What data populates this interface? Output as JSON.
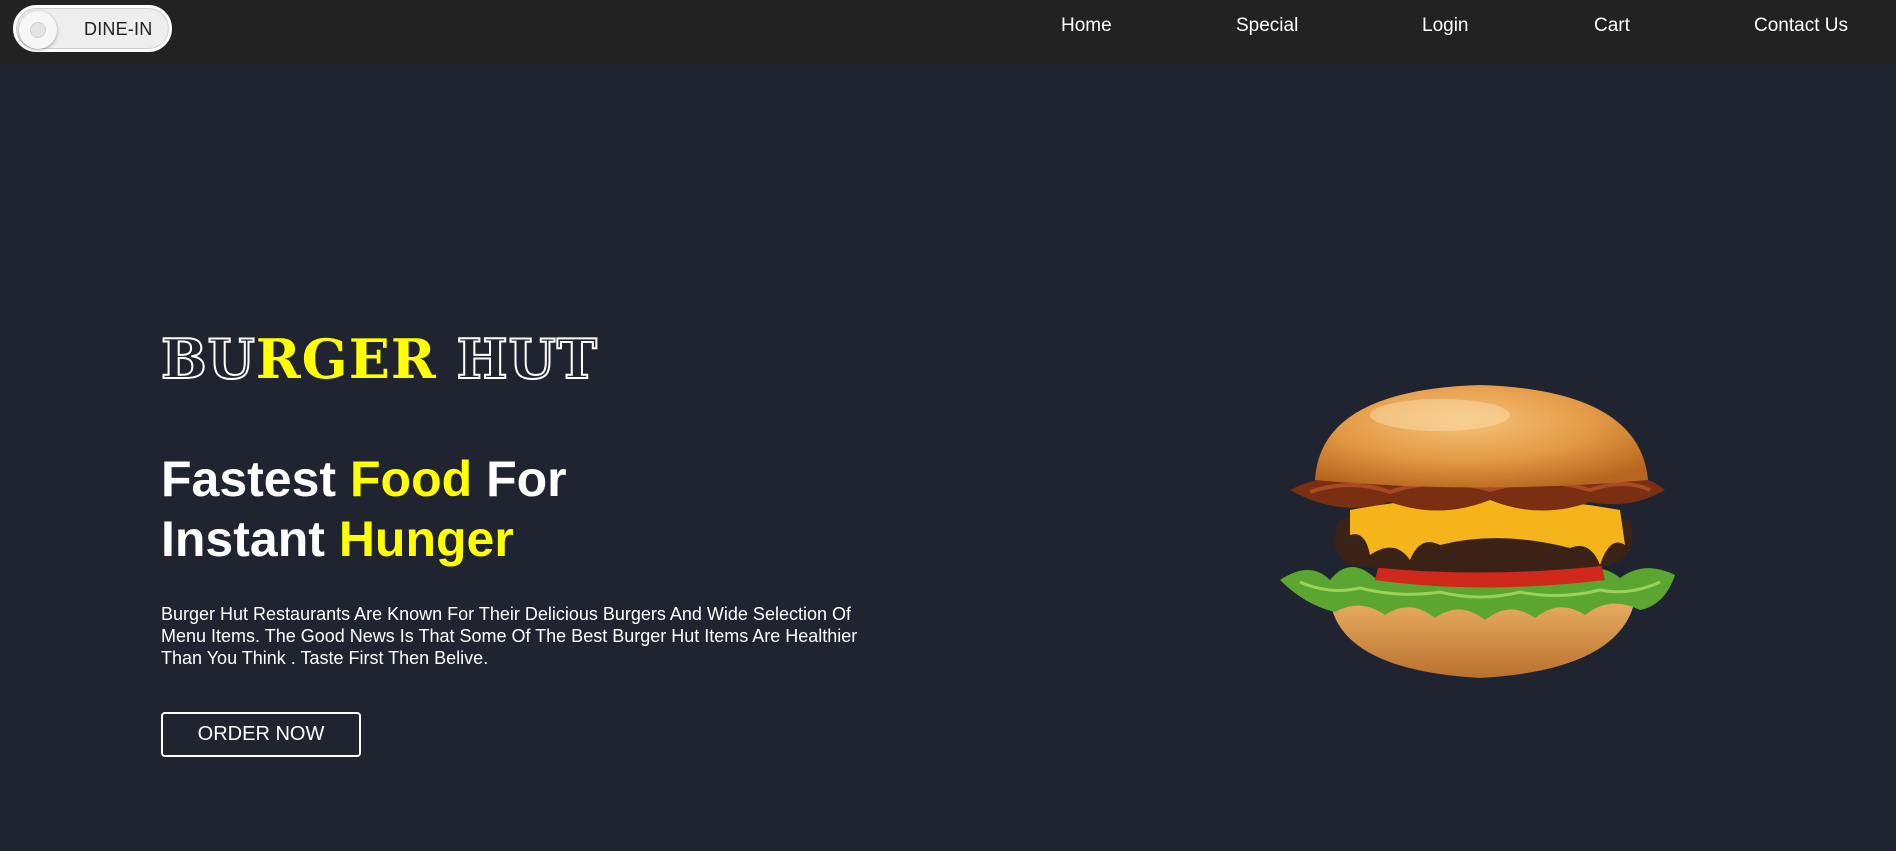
{
  "navbar": {
    "toggle_label": "DINE-IN",
    "links": [
      "Home",
      "Special",
      "Login",
      "Cart",
      "Contact Us"
    ]
  },
  "hero": {
    "brand": {
      "part1": "BU",
      "part2": "RGE",
      "part3": "R",
      "part4": "HUT"
    },
    "headline": {
      "w1": "Fastest",
      "w2": "Food",
      "w3": "For",
      "w4": "Instant",
      "w5": "Hunger"
    },
    "description": "Burger Hut Restaurants Are Known For Their Delicious Burgers And Wide Selection Of Menu Items. The Good News Is That Some Of The Best Burger Hut Items Are Healthier Than You Think . Taste First Then Belive.",
    "cta_label": "ORDER NOW"
  },
  "colors": {
    "background": "#202431",
    "navbar": "#222222",
    "accent": "#ffff00",
    "text": "#ffffff"
  },
  "icons": {
    "toggle": "toggle-switch-icon",
    "hero_image": "burger-image"
  }
}
